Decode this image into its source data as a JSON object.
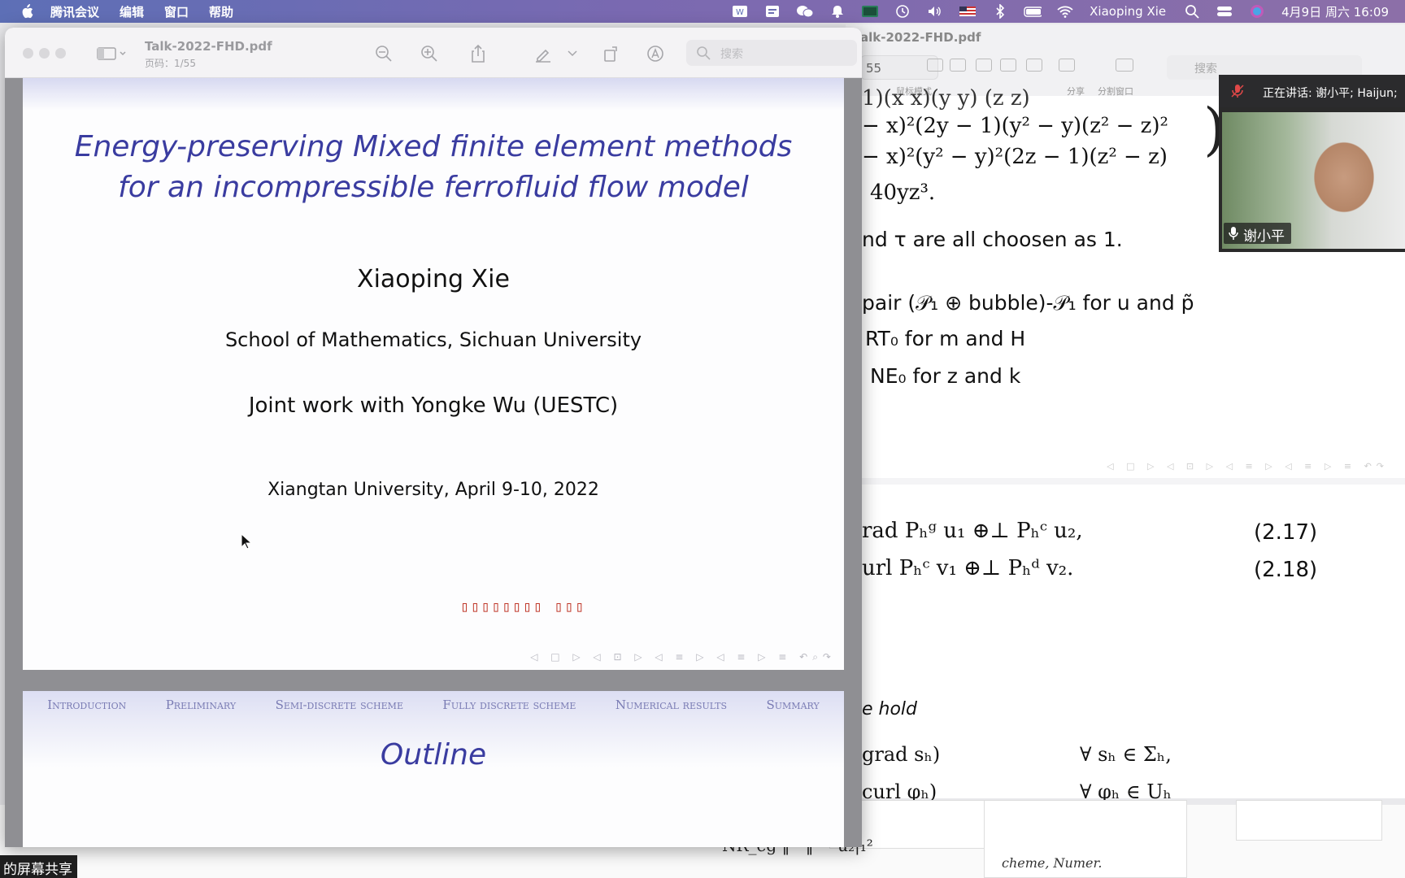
{
  "menubar": {
    "app_name": "腾讯会议",
    "menus": [
      "编辑",
      "窗口",
      "帮助"
    ],
    "user_name": "Xiaoping Xie",
    "datetime": "4月9日 周六 16:09",
    "tray_icons": [
      "wps-icon",
      "clipboard-icon",
      "wechat-icon",
      "bell-icon",
      "screen-icon",
      "time-machine-icon",
      "volume-icon",
      "flag-us-icon",
      "bluetooth-icon",
      "battery-icon",
      "wifi-icon"
    ]
  },
  "main_window": {
    "title": "Talk-2022-FHD.pdf",
    "page_info": "页码：1/55",
    "search_placeholder": "搜索",
    "slide1": {
      "title_line1": "Energy-preserving Mixed finite element methods",
      "title_line2": "for an incompressible ferrofluid flow model",
      "author": "Xiaoping Xie",
      "affiliation": "School of Mathematics, Sichuan University",
      "joint": "Joint work with Yongke Wu (UESTC)",
      "venue": "Xiangtan University, April 9-10, 2022",
      "garbled_text": "▯▯▯▯▯▯▯▯ ▯▯▯"
    },
    "slide2": {
      "nav_sections": [
        "Introduction",
        "Preliminary",
        "Semi-discrete scheme",
        "Fully discrete scheme",
        "Numerical results",
        "Summary"
      ],
      "heading": "Outline"
    }
  },
  "bg_window": {
    "title": "alk-2022-FHD.pdf",
    "page": "55",
    "search_placeholder": "搜索",
    "labels": [
      "鼠标模式",
      "分享",
      "分割窗口"
    ],
    "slide_a": {
      "line1": "1)(x     x)(y     y) (z     z)",
      "line2": "− x)²(2y − 1)(y² − y)(z² − z)²",
      "line3": "− x)²(y² − y)²(2z − 1)(z² − z)",
      "line4": "40yz³.",
      "line5": "nd τ are all choosen as 1.",
      "line6": "pair (𝒫₁ ⊕ bubble)-𝒫₁ for u and p̃",
      "line7": "RT₀ for m and H",
      "line8": "NE₀ for z and k"
    },
    "slide_b": {
      "eq1": "rad Pₕᵍ u₁ ⊕⊥ Pₕᶜ u₂,",
      "eq1_num": "(2.17)",
      "eq2": "url Pₕᶜ v₁ ⊕⊥ Pₕᵈ v₂.",
      "eq2_num": "(2.18)",
      "hold": "e hold",
      "eq3": "grad sₕ)",
      "eq3_right": "∀  sₕ ∈ Σₕ,",
      "eq4": "curl φₕ)",
      "eq4_right": "∀  φₕ ∈ Uₕ"
    }
  },
  "video": {
    "speaking": "正在讲话: 谢小平; Haijun;",
    "name": "谢小平"
  },
  "share_tag": "的屏幕共享",
  "bottom": {
    "math_line": "NR_eg ‖ · ‖ − u₂|₁²",
    "ref_text": "cheme, Numer."
  }
}
